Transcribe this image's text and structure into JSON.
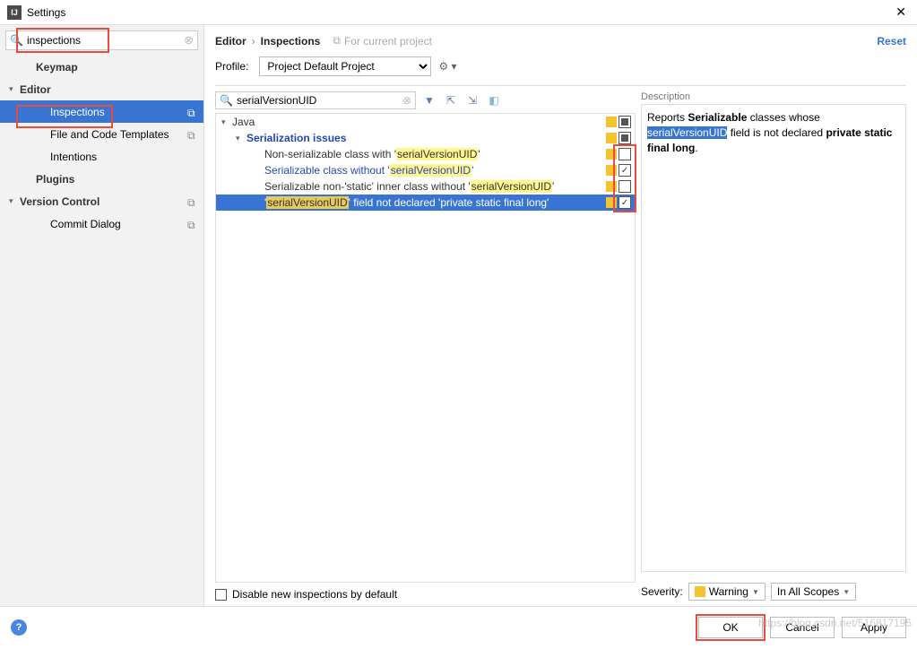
{
  "window": {
    "title": "Settings"
  },
  "sidebar": {
    "search_value": "inspections",
    "items": [
      {
        "label": "Keymap",
        "bold": true,
        "arrow": "",
        "indent": 1,
        "proj": false
      },
      {
        "label": "Editor",
        "bold": true,
        "arrow": "▾",
        "indent": 0,
        "proj": false
      },
      {
        "label": "Inspections",
        "bold": false,
        "arrow": "",
        "indent": 2,
        "proj": true,
        "selected": true
      },
      {
        "label": "File and Code Templates",
        "bold": false,
        "arrow": "",
        "indent": 2,
        "proj": true
      },
      {
        "label": "Intentions",
        "bold": false,
        "arrow": "",
        "indent": 2,
        "proj": false
      },
      {
        "label": "Plugins",
        "bold": true,
        "arrow": "",
        "indent": 1,
        "proj": false
      },
      {
        "label": "Version Control",
        "bold": true,
        "arrow": "▾",
        "indent": 0,
        "proj": true
      },
      {
        "label": "Commit Dialog",
        "bold": false,
        "arrow": "",
        "indent": 2,
        "proj": true
      }
    ]
  },
  "breadcrumb": {
    "a": "Editor",
    "b": "Inspections",
    "hint": "For current project",
    "reset": "Reset"
  },
  "profile": {
    "label": "Profile:",
    "selected": "Project Default  Project"
  },
  "filter": {
    "value": "serialVersionUID"
  },
  "inspections": {
    "cat": "Java",
    "group": "Serialization issues",
    "rows": [
      {
        "pre": "Non-serializable class with '",
        "hl": "serialVersionUID",
        "post": "'",
        "link": false,
        "chk": "empty"
      },
      {
        "pre": "Serializable class without '",
        "hl": "serialVersionUID",
        "post": "'",
        "link": true,
        "chk": "checked"
      },
      {
        "pre": "Serializable non-'static' inner class without '",
        "hl": "serialVersionUID",
        "post": "'",
        "link": false,
        "chk": "empty"
      },
      {
        "pre": "'",
        "hl": "serialVersionUID",
        "post": "' field not declared 'private static final long'",
        "link": false,
        "chk": "checked",
        "selected": true
      }
    ]
  },
  "description": {
    "label": "Description",
    "text_pre": "Reports ",
    "bold1": "Serializable",
    "text_mid": " classes whose ",
    "sel": "serialVersionUID",
    "text_mid2": " field is not declared ",
    "bold2": "private static final long",
    "text_post": "."
  },
  "severity": {
    "label": "Severity:",
    "value": "Warning",
    "scope": "In All Scopes"
  },
  "bottom": {
    "label": "Disable new inspections by default"
  },
  "footer": {
    "ok": "OK",
    "cancel": "Cancel",
    "apply": "Apply"
  },
  "watermark": "https://blog.csdn.net/516817195"
}
